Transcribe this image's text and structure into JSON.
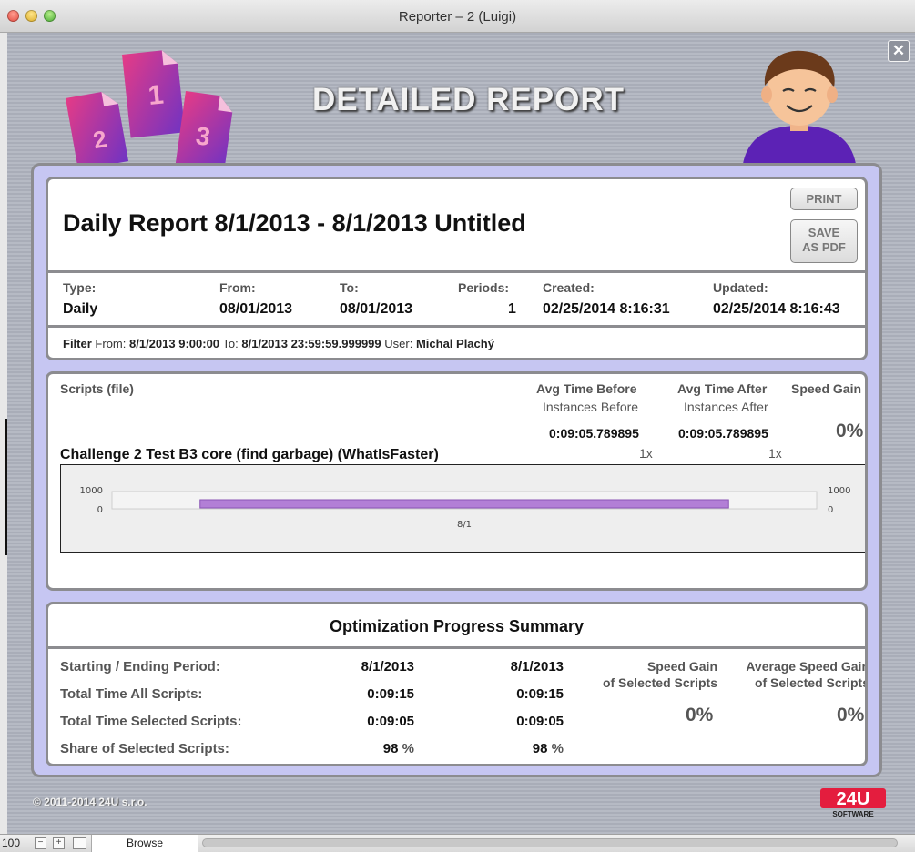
{
  "window": {
    "title": "Reporter – 2 (Luigi)"
  },
  "header": {
    "heading": "DETAILED REPORT",
    "doc_numbers": [
      "2",
      "1",
      "3"
    ],
    "close_label": "✕"
  },
  "report": {
    "title": "Daily Report 8/1/2013 - 8/1/2013 Untitled",
    "print_label": "PRINT",
    "save_pdf_line1": "SAVE",
    "save_pdf_line2": "AS PDF",
    "meta": {
      "type_label": "Type:",
      "type_value": "Daily",
      "from_label": "From:",
      "from_value": "08/01/2013",
      "to_label": "To:",
      "to_value": "08/01/2013",
      "periods_label": "Periods:",
      "periods_value": "1",
      "created_label": "Created:",
      "created_value": "02/25/2014 8:16:31",
      "updated_label": "Updated:",
      "updated_value": "02/25/2014 8:16:43"
    },
    "filter": {
      "label": "Filter",
      "from_label": "From:",
      "from_value": "8/1/2013 9:00:00",
      "to_label": "To:",
      "to_value": "8/1/2013 23:59:59.999999",
      "user_label": "User:",
      "user_value": "Michal Plachý"
    }
  },
  "scripts": {
    "header_label": "Scripts (file)",
    "avg_before_label": "Avg Time Before",
    "instances_before_label": "Instances Before",
    "avg_after_label": "Avg Time After",
    "instances_after_label": "Instances After",
    "speed_gain_label": "Speed Gain",
    "rows": [
      {
        "name": "Challenge 2 Test B3 core (find garbage) (WhatIsFaster)",
        "avg_before": "0:09:05.789895",
        "instances_before": "1x",
        "avg_after": "0:09:05.789895",
        "instances_after": "1x",
        "speed_gain": "0%"
      }
    ]
  },
  "chart_data": {
    "type": "bar",
    "categories": [
      "8/1"
    ],
    "values": [
      545.79
    ],
    "ylim": [
      0,
      1000
    ],
    "y_ticks_left": [
      "1000",
      "0"
    ],
    "y_ticks_right": [
      "1000",
      "0"
    ],
    "bar_color": "#b27fd6",
    "grid": false
  },
  "summary": {
    "title": "Optimization Progress Summary",
    "rows": [
      {
        "label": "Starting / Ending Period:",
        "start": "8/1/2013",
        "end": "8/1/2013"
      },
      {
        "label": "Total Time All Scripts:",
        "start": "0:09:15",
        "end": "0:09:15"
      },
      {
        "label": "Total Time Selected Scripts:",
        "start": "0:09:05",
        "end": "0:09:05"
      },
      {
        "label": "Share of Selected Scripts:",
        "start": "98",
        "end": "98",
        "unit": "%"
      }
    ],
    "speed_gain_label1": "Speed Gain",
    "speed_gain_label2": "of Selected Scripts",
    "speed_gain_value": "0%",
    "avg_speed_gain_label1": "Average Speed Gain",
    "avg_speed_gain_label2": "of Selected Scripts",
    "avg_speed_gain_value": "0%"
  },
  "footer": {
    "copyright": "© 2011-2014 24U s.r.o.",
    "brand_top": "24U",
    "brand_bottom": "SOFTWARE"
  },
  "statusbar": {
    "zoom": "100",
    "mode": "Browse"
  },
  "colors": {
    "panel_bg": "#c6c6f2",
    "accent_pink": "#d8337f",
    "accent_purple": "#7a3fc6"
  }
}
